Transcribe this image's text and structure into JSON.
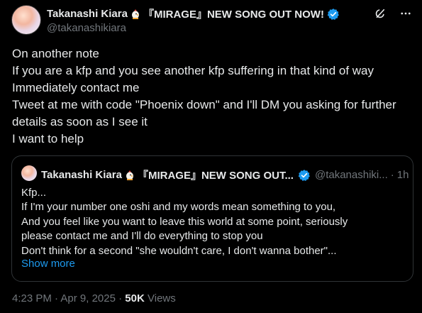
{
  "author": {
    "display_name": "Takanashi Kiara",
    "name_suffix": "『MIRAGE』NEW SONG OUT NOW!",
    "handle": "@takanashikiara"
  },
  "post": {
    "lines": [
      "On another note",
      "If you are a kfp and you see another kfp suffering in that kind of way",
      "Immediately contact me",
      "Tweet at me with code \"Phoenix down\" and I'll DM you asking for further",
      "details as soon as I see it",
      "I want to help"
    ]
  },
  "quoted": {
    "display_name": "Takanashi Kiara",
    "name_suffix": "『MIRAGE』NEW SONG OUT...",
    "handle": "@takanashiki...",
    "separator": "·",
    "time": "1h",
    "lines": [
      "Kfp...",
      "If I'm your number one oshi and my words mean something to you,",
      "And you feel like you want to leave this world at some point, seriously",
      "please contact me and I'll do everything to stop you",
      "Don't think for a second \"she wouldn't care, I don't wanna bother\"..."
    ],
    "show_more": "Show more"
  },
  "meta": {
    "time": "4:23 PM",
    "separator": "·",
    "date": "Apr 9, 2025",
    "separator2": "·",
    "views_count": "50K",
    "views_label": "Views"
  },
  "icons": {
    "grok": "grok-icon",
    "more": "more-icon",
    "verified": "verified-badge-icon",
    "emoji": "bird-emoji-icon"
  },
  "colors": {
    "background": "#000000",
    "text": "#e7e9ea",
    "secondary": "#71767b",
    "accent": "#1d9bf0",
    "border": "#2f3336"
  }
}
